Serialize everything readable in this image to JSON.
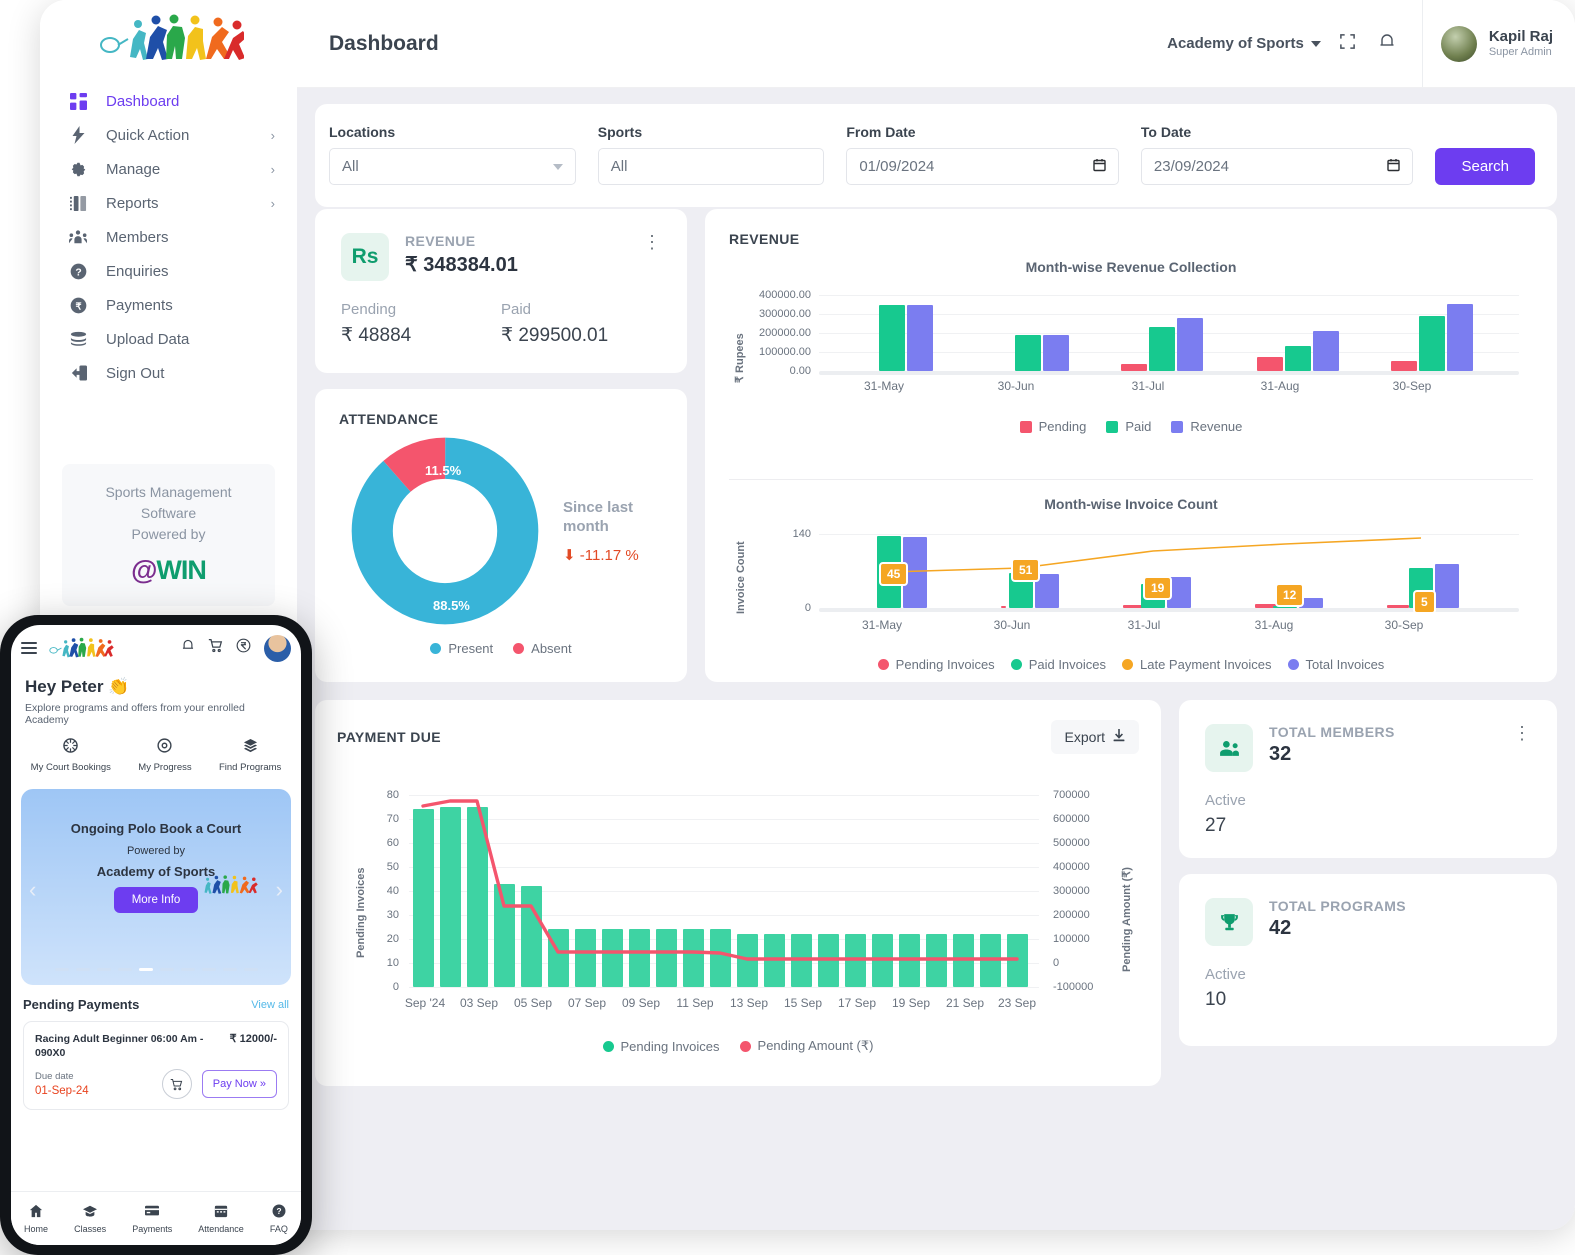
{
  "sidebar": {
    "logo_alt": "sports-logo",
    "items": [
      {
        "label": "Dashboard",
        "icon": "grid-icon",
        "chevron": false,
        "active": true
      },
      {
        "label": "Quick Action",
        "icon": "bolt-icon",
        "chevron": true,
        "active": false
      },
      {
        "label": "Manage",
        "icon": "gear-icon",
        "chevron": true,
        "active": false
      },
      {
        "label": "Reports",
        "icon": "report-icon",
        "chevron": true,
        "active": false
      },
      {
        "label": "Members",
        "icon": "members-icon",
        "chevron": false,
        "active": false
      },
      {
        "label": "Enquiries",
        "icon": "question-circle-icon",
        "chevron": false,
        "active": false
      },
      {
        "label": "Payments",
        "icon": "rupee-circle-icon",
        "chevron": false,
        "active": false
      },
      {
        "label": "Upload Data",
        "icon": "database-icon",
        "chevron": false,
        "active": false
      },
      {
        "label": "Sign Out",
        "icon": "signout-icon",
        "chevron": false,
        "active": false
      }
    ],
    "footer": {
      "line1": "Sports Management",
      "line2": "Software",
      "line3": "Powered by",
      "brand_at": "@",
      "brand_win": "WIN"
    }
  },
  "topbar": {
    "title": "Dashboard",
    "org": "Academy of Sports",
    "user_name": "Kapil Raj",
    "user_role": "Super Admin"
  },
  "filters": {
    "locations_label": "Locations",
    "locations_value": "All",
    "sports_label": "Sports",
    "sports_value": "All",
    "from_label": "From Date",
    "from_value": "01/09/2024",
    "to_label": "To Date",
    "to_value": "23/09/2024",
    "search_label": "Search"
  },
  "revenue_card": {
    "icon_text": "Rs",
    "title": "REVENUE",
    "value": "₹ 348384.01",
    "pending_label": "Pending",
    "pending_value": "₹  48884",
    "paid_label": "Paid",
    "paid_value": "₹  299500.01"
  },
  "attendance": {
    "title": "ATTENDANCE",
    "absent_pct_label": "11.5%",
    "present_pct_label": "88.5%",
    "since_label": "Since last month",
    "since_value": "-11.17 %",
    "legend": [
      "Present",
      "Absent"
    ]
  },
  "revenue_panel": {
    "title": "REVENUE"
  },
  "payment_due": {
    "title": "PAYMENT DUE",
    "export_label": "Export"
  },
  "members_card": {
    "title": "TOTAL MEMBERS",
    "value": "32",
    "active_label": "Active",
    "active_value": "27",
    "icon": "members-icon"
  },
  "programs_card": {
    "title": "TOTAL PROGRAMS",
    "value": "42",
    "active_label": "Active",
    "active_value": "10",
    "icon": "trophy-icon"
  },
  "phone": {
    "greeting": "Hey Peter 👏",
    "subtitle": "Explore programs and offers from your enrolled Academy",
    "quick": [
      {
        "label": "My Court Bookings",
        "icon": "court-icon"
      },
      {
        "label": "My Progress",
        "icon": "progress-icon"
      },
      {
        "label": "Find Programs",
        "icon": "layers-icon"
      }
    ],
    "banner": {
      "title": "Ongoing Polo Book a Court",
      "powered": "Powered by",
      "academy": "Academy of Sports",
      "cta": "More Info"
    },
    "pending": {
      "title": "Pending Payments",
      "view_all": "View all",
      "item_name": "Racing Adult Beginner 06:00 Am - 090X0",
      "item_amount": "₹ 12000/-",
      "due_label": "Due date",
      "due_value": "01-Sep-24",
      "pay_label": "Pay Now »"
    },
    "tabs": [
      {
        "label": "Home",
        "icon": "home-icon"
      },
      {
        "label": "Classes",
        "icon": "graduation-icon"
      },
      {
        "label": "Payments",
        "icon": "card-icon"
      },
      {
        "label": "Attendance",
        "icon": "calendar-icon"
      },
      {
        "label": "FAQ",
        "icon": "question-circle-icon"
      }
    ]
  },
  "colors": {
    "accent": "#6d3df0",
    "green": "#17c98f",
    "blue": "#7b7df0",
    "pink": "#f4556d",
    "orange": "#f5a623",
    "cyan": "#38b4d8"
  },
  "chart_data": [
    {
      "type": "bar",
      "title": "Month-wise Revenue Collection",
      "xlabel": "",
      "ylabel": "₹ Rupees",
      "categories": [
        "31-May",
        "30-Jun",
        "31-Jul",
        "31-Aug",
        "30-Sep"
      ],
      "ylim": [
        0,
        400000
      ],
      "yticks": [
        "0.00",
        "100000.00",
        "200000.00",
        "300000.00",
        "400000.00"
      ],
      "grid": true,
      "legend_position": "bottom",
      "series": [
        {
          "name": "Pending",
          "color": "#f4556d",
          "values": [
            0,
            0,
            35000,
            72000,
            51000
          ]
        },
        {
          "name": "Paid",
          "color": "#17c98f",
          "values": [
            347000,
            189000,
            231000,
            131000,
            291000
          ]
        },
        {
          "name": "Revenue",
          "color": "#7b7df0",
          "values": [
            347000,
            189000,
            277000,
            212000,
            350000
          ]
        }
      ]
    },
    {
      "type": "bar",
      "title": "Month-wise Invoice Count",
      "xlabel": "",
      "ylabel": "Invoice Count",
      "categories": [
        "31-May",
        "30-Jun",
        "31-Jul",
        "31-Aug",
        "30-Sep"
      ],
      "ylim": [
        0,
        140
      ],
      "yticks": [
        "0",
        "140"
      ],
      "grid": true,
      "legend_position": "bottom",
      "series": [
        {
          "name": "Pending Invoices",
          "color": "#f4556d",
          "values": [
            0,
            2,
            5,
            7,
            4
          ]
        },
        {
          "name": "Paid Invoices",
          "color": "#17c98f",
          "values": [
            136,
            66,
            45,
            3,
            74
          ]
        },
        {
          "name": "Late Payment Invoices",
          "color": "#f5a623",
          "values": [
            45,
            51,
            19,
            12,
            5
          ],
          "line": true,
          "labels": [
            "45",
            "51",
            "19",
            "12",
            "5"
          ]
        },
        {
          "name": "Total Invoices",
          "color": "#7b7df0",
          "values": [
            135,
            64,
            58,
            18,
            80
          ]
        }
      ]
    },
    {
      "type": "bar",
      "title": "PAYMENT DUE",
      "xlabel": "",
      "ylabel": "Pending Invoices",
      "y2label": "Pending Amount (₹)",
      "categories": [
        "Sep '24",
        "02 Sep",
        "03 Sep",
        "04 Sep",
        "05 Sep",
        "06 Sep",
        "07 Sep",
        "08 Sep",
        "09 Sep",
        "10 Sep",
        "11 Sep",
        "12 Sep",
        "13 Sep",
        "14 Sep",
        "15 Sep",
        "16 Sep",
        "17 Sep",
        "18 Sep",
        "19 Sep",
        "20 Sep",
        "21 Sep",
        "22 Sep",
        "23 Sep"
      ],
      "xticks_shown": [
        "Sep '24",
        "03 Sep",
        "05 Sep",
        "07 Sep",
        "09 Sep",
        "11 Sep",
        "13 Sep",
        "15 Sep",
        "17 Sep",
        "19 Sep",
        "21 Sep",
        "23 Sep"
      ],
      "ylim": [
        0,
        80
      ],
      "yticks": [
        "0",
        "10",
        "20",
        "30",
        "40",
        "50",
        "60",
        "70",
        "80"
      ],
      "y2lim": [
        -100000,
        700000
      ],
      "y2ticks": [
        "-100000",
        "0",
        "100000",
        "200000",
        "300000",
        "400000",
        "500000",
        "600000",
        "700000"
      ],
      "grid": true,
      "legend_position": "bottom",
      "series": [
        {
          "name": "Pending Invoices",
          "color": "#17c98f",
          "type": "bar",
          "values": [
            74,
            75,
            75,
            43,
            42,
            24,
            24,
            24,
            24,
            24,
            24,
            24,
            22,
            22,
            22,
            22,
            22,
            22,
            22,
            22,
            22,
            22,
            22
          ]
        },
        {
          "name": "Pending Amount (₹)",
          "color": "#f4556d",
          "type": "line",
          "values": [
            660000,
            672000,
            672000,
            370000,
            370000,
            185000,
            185000,
            185000,
            185000,
            185000,
            185000,
            183000,
            172000,
            172000,
            172000,
            172000,
            172000,
            172000,
            172000,
            172000,
            172000,
            172000,
            172000
          ]
        }
      ]
    },
    {
      "type": "pie",
      "title": "ATTENDANCE",
      "labels": [
        "Present",
        "Absent"
      ],
      "values": [
        88.5,
        11.5
      ],
      "colors": [
        "#38b4d8",
        "#f4556d"
      ]
    }
  ]
}
